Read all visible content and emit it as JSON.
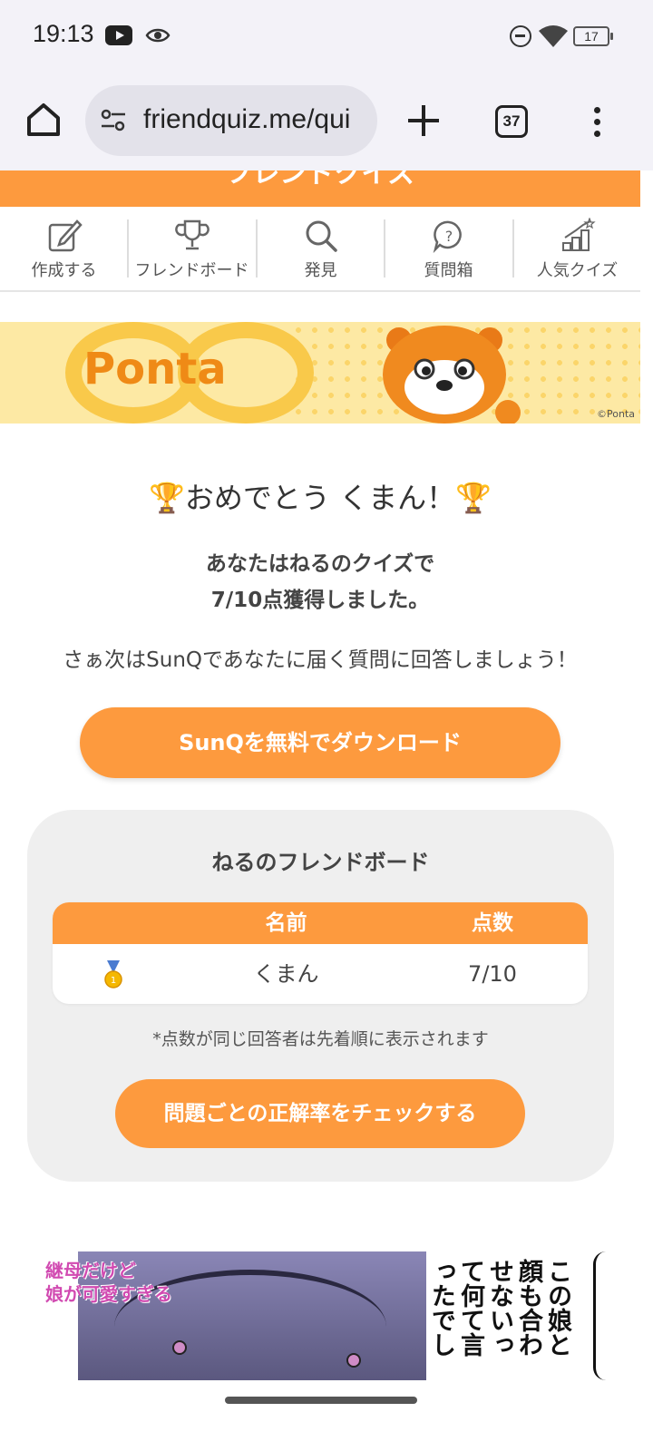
{
  "status_bar": {
    "time": "19:13",
    "battery": "17",
    "icons": [
      "youtube-icon",
      "eye-icon",
      "do-not-disturb-icon",
      "wifi-icon",
      "battery-icon"
    ]
  },
  "browser": {
    "url": "friendquiz.me/qui",
    "tab_count": "37"
  },
  "site": {
    "title": "フレンドクイズ",
    "accent_color": "#fd9a3e"
  },
  "nav": {
    "items": [
      {
        "label": "作成する",
        "icon": "edit-icon"
      },
      {
        "label": "フレンドボード",
        "icon": "trophy-icon"
      },
      {
        "label": "発見",
        "icon": "search-icon"
      },
      {
        "label": "質問箱",
        "icon": "question-bubble-icon"
      },
      {
        "label": "人気クイズ",
        "icon": "ranking-icon"
      }
    ]
  },
  "ponta_ad": {
    "logo": "Ponta",
    "copyright": "©Ponta"
  },
  "result": {
    "congrats": "🏆おめでとう くまん！🏆",
    "score_line1": "あなたはねるのクイズで",
    "score_line2": "7/10点獲得しました。",
    "cta": "さぁ次はSunQであなたに届く質問に回答しましょう！",
    "download_button": "SunQを無料でダウンロード"
  },
  "board": {
    "title": "ねるのフレンドボード",
    "columns": [
      "",
      "名前",
      "点数"
    ],
    "rows": [
      {
        "rank": "🥇",
        "name": "くまん",
        "score": "7/10"
      }
    ],
    "note": "*点数が同じ回答者は先着順に表示されます",
    "check_button": "問題ごとの正解率をチェックする"
  },
  "manga_ad": {
    "title_line1": "継母だけど",
    "title_line2": "娘が可愛すぎる",
    "speech": "この娘と顔も合わせないって何て言ったでし"
  }
}
